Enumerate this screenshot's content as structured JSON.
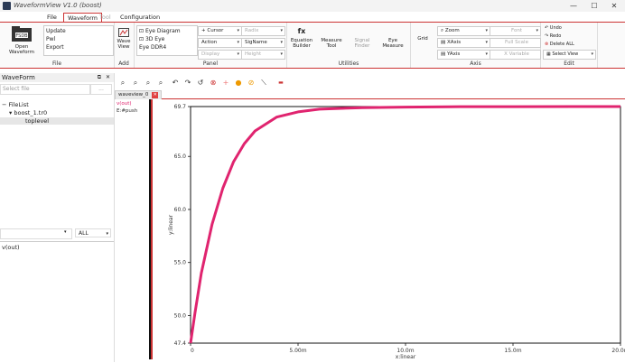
{
  "window": {
    "title": "WaveformView V1.0 (boost)",
    "controls": [
      "—",
      "☐",
      "✕"
    ]
  },
  "menu": {
    "tabs": [
      {
        "label": "File",
        "state": "normal"
      },
      {
        "label": "Waveform",
        "state": "active"
      },
      {
        "label": "Tool",
        "state": "disabled"
      },
      {
        "label": "Configuration",
        "state": "normal"
      }
    ]
  },
  "ribbon": {
    "file": {
      "open_label_1": "Open",
      "open_label_2": "Waveform",
      "items": [
        "Update",
        "Pwl",
        "Export"
      ],
      "group_label": "File"
    },
    "add": {
      "wave_view_1": "Wave",
      "wave_view_2": "View",
      "group_label": "Add"
    },
    "panel": {
      "eye_list": [
        "Eye Diagram",
        "3D Eye",
        "Eye DDR4"
      ],
      "cursor": "Cursor",
      "action": "Action",
      "display": "Display",
      "radix": "Radix",
      "signame": "SigName",
      "height": "Height",
      "group_label": "Panel"
    },
    "utilities": {
      "fx": "fx",
      "equation_1": "Equation",
      "equation_2": "Builder",
      "measure_1": "Measure",
      "measure_2": "Tool",
      "signal_1": "Signal",
      "signal_2": "Finder",
      "eye_1": "Eye",
      "eye_2": "Measure",
      "group_label": "Utilities"
    },
    "axis": {
      "grid": "Grid",
      "zoom": "Zoom",
      "xaxis": "XAxis",
      "yaxis": "YAxis",
      "font": "Font",
      "full_scale": "Full Scale",
      "x_variable": "X Variable",
      "group_label": "Axis"
    },
    "edit": {
      "undo": "Undo",
      "redo": "Redo",
      "delete_all": "Delete ALL",
      "select_view": "Select View",
      "group_label": "Edit"
    }
  },
  "sidebar": {
    "header": "WaveForm",
    "filter_placeholder": "Select file",
    "filter_btn": "...",
    "tree": [
      {
        "label": "FileList",
        "depth": 0,
        "toggle": "−"
      },
      {
        "label": "boost_1.tr0",
        "depth": 1,
        "toggle": "▾"
      },
      {
        "label": "toplevel",
        "depth": 2,
        "toggle": ""
      }
    ],
    "filter_select": "ALL",
    "signals": [
      "v(out)"
    ]
  },
  "waveview": {
    "tab_label": "waveview_0",
    "signal_name": "v(out)",
    "signal_sub": "E:#push"
  },
  "chart_data": {
    "type": "line",
    "xlabel": "x:linear",
    "ylabel": "y:linear",
    "xlim": [
      0,
      0.02
    ],
    "ylim": [
      47.4,
      69.7
    ],
    "x_ticks": [
      {
        "v": 0,
        "label": "0"
      },
      {
        "v": 0.005,
        "label": "5.00m"
      },
      {
        "v": 0.01,
        "label": "10.0m"
      },
      {
        "v": 0.015,
        "label": "15.0m"
      },
      {
        "v": 0.02,
        "label": "20.0m"
      }
    ],
    "y_ticks": [
      {
        "v": 47.4,
        "label": "47.4"
      },
      {
        "v": 50.0,
        "label": "50.0"
      },
      {
        "v": 55.0,
        "label": "55.0"
      },
      {
        "v": 60.0,
        "label": "60.0"
      },
      {
        "v": 65.0,
        "label": "65.0"
      },
      {
        "v": 69.7,
        "label": "69.7"
      }
    ],
    "grid": false,
    "series": [
      {
        "name": "v(out)",
        "color": "#e0246f",
        "x": [
          0,
          0.0002,
          0.0005,
          0.001,
          0.0015,
          0.002,
          0.0025,
          0.003,
          0.004,
          0.005,
          0.006,
          0.008,
          0.01,
          0.012,
          0.015,
          0.02
        ],
        "y": [
          47.4,
          50.2,
          54.0,
          58.6,
          62.0,
          64.5,
          66.2,
          67.4,
          68.7,
          69.2,
          69.45,
          69.6,
          69.65,
          69.68,
          69.69,
          69.7
        ]
      }
    ]
  },
  "colors": {
    "accent": "#cc3333",
    "trace": "#e0246f"
  }
}
